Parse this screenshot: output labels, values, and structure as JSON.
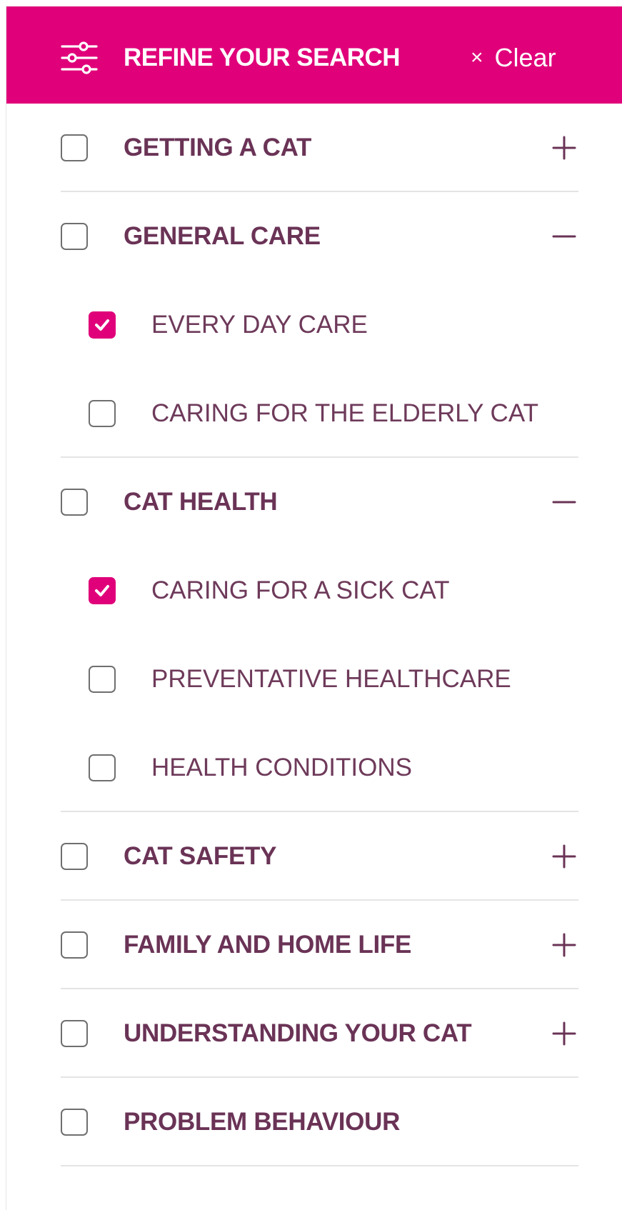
{
  "header": {
    "title": "REFINE YOUR SEARCH",
    "clear_label": "Clear",
    "clear_icon": "×",
    "filter_icon": "sliders-icon"
  },
  "colors": {
    "accent": "#e0007a",
    "label_text": "#6a3356",
    "checkbox_border": "#6f6f6f",
    "divider": "#e4e4e4"
  },
  "categories": [
    {
      "label": "GETTING A CAT",
      "checked": false,
      "expanded": false,
      "toggle_icon": "plus-icon",
      "children": []
    },
    {
      "label": "GENERAL CARE",
      "checked": false,
      "expanded": true,
      "toggle_icon": "minus-icon",
      "children": [
        {
          "label": "EVERY DAY CARE",
          "checked": true
        },
        {
          "label": "CARING FOR THE ELDERLY CAT",
          "checked": false
        }
      ]
    },
    {
      "label": "CAT HEALTH",
      "checked": false,
      "expanded": true,
      "toggle_icon": "minus-icon",
      "children": [
        {
          "label": "CARING FOR A SICK CAT",
          "checked": true
        },
        {
          "label": "PREVENTATIVE HEALTHCARE",
          "checked": false
        },
        {
          "label": "HEALTH CONDITIONS",
          "checked": false
        }
      ]
    },
    {
      "label": "CAT SAFETY",
      "checked": false,
      "expanded": false,
      "toggle_icon": "plus-icon",
      "children": []
    },
    {
      "label": "FAMILY AND HOME LIFE",
      "checked": false,
      "expanded": false,
      "toggle_icon": "plus-icon",
      "children": []
    },
    {
      "label": "UNDERSTANDING YOUR CAT",
      "checked": false,
      "expanded": false,
      "toggle_icon": "plus-icon",
      "children": []
    },
    {
      "label": "PROBLEM BEHAVIOUR",
      "checked": false,
      "expanded": false,
      "toggle_icon": "none",
      "children": []
    }
  ]
}
